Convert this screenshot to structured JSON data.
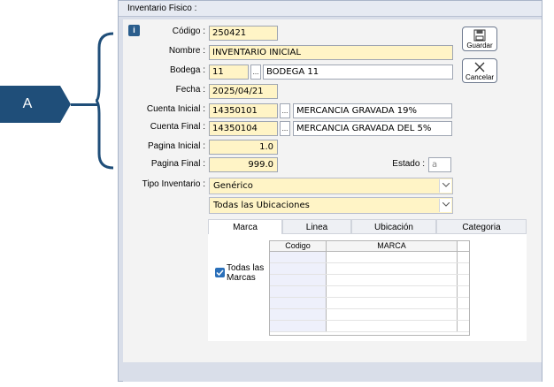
{
  "annotation": {
    "label": "A"
  },
  "window": {
    "title": "Inventario Fisico :"
  },
  "form": {
    "codigo": {
      "label": "Código :",
      "value": "250421"
    },
    "nombre": {
      "label": "Nombre :",
      "value": "INVENTARIO INICIAL"
    },
    "bodega": {
      "label": "Bodega :",
      "code": "11",
      "name": "BODEGA 11",
      "button": "..."
    },
    "fecha": {
      "label": "Fecha :",
      "value": "2025/04/21"
    },
    "cuenta_inicial": {
      "label": "Cuenta Inicial :",
      "code": "14350101",
      "name": "MERCANCIA GRAVADA 19%",
      "button": "..."
    },
    "cuenta_final": {
      "label": "Cuenta Final :",
      "code": "14350104",
      "name": "MERCANCIA GRAVADA DEL 5%",
      "button": "..."
    },
    "pagina_inicial": {
      "label": "Pagina Inicial :",
      "value": "1.0"
    },
    "pagina_final": {
      "label": "Pagina Final :",
      "value": "999.0"
    },
    "estado": {
      "label": "Estado :",
      "value": "a"
    },
    "tipo_inventario": {
      "label": "Tipo Inventario :",
      "value": "Genérico"
    },
    "ubicaciones": {
      "value": "Todas las Ubicaciones"
    }
  },
  "toolbar": {
    "guardar": "Guardar",
    "cancelar": "Cancelar"
  },
  "tabs": [
    {
      "label": "Marca",
      "active": true
    },
    {
      "label": "Linea",
      "active": false
    },
    {
      "label": "Ubicación",
      "active": false
    },
    {
      "label": "Categoria",
      "active": false
    }
  ],
  "marca_panel": {
    "checkbox_label_1": "Todas las",
    "checkbox_label_2": "Marcas",
    "checked": true,
    "columns": [
      "Codigo",
      "MARCA"
    ]
  },
  "colors": {
    "accent": "#1f4e79",
    "field_bg": "#fff4c6",
    "checkbox": "#2a6fb9"
  }
}
